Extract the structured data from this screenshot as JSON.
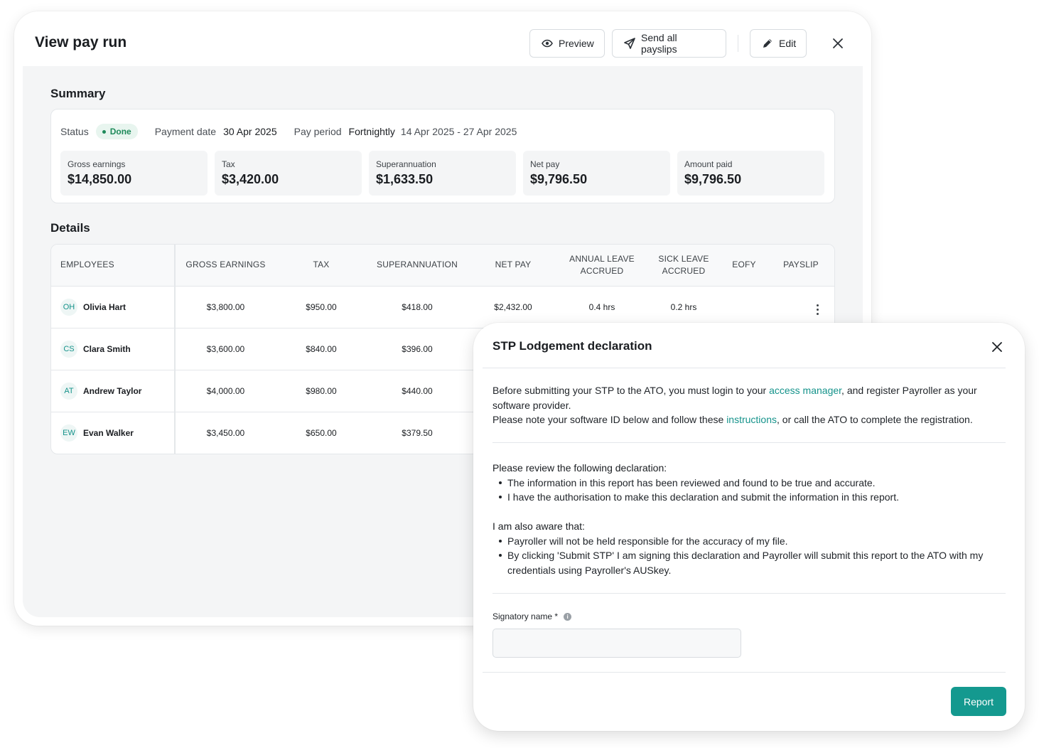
{
  "payrun": {
    "title": "View pay run",
    "toolbar": {
      "preview_label": "Preview",
      "send_label": "Send all payslips",
      "edit_label": "Edit"
    },
    "summary": {
      "title": "Summary",
      "status_label": "Status",
      "status_value": "Done",
      "payment_date_label": "Payment date",
      "payment_date_value": "30 Apr 2025",
      "pay_period_label": "Pay period",
      "pay_period_frequency": "Fortnightly",
      "pay_period_range": "14 Apr 2025 - 27 Apr 2025",
      "stats": [
        {
          "label": "Gross earnings",
          "value": "$14,850.00"
        },
        {
          "label": "Tax",
          "value": "$3,420.00"
        },
        {
          "label": "Superannuation",
          "value": "$1,633.50"
        },
        {
          "label": "Net pay",
          "value": "$9,796.50"
        },
        {
          "label": "Amount paid",
          "value": "$9,796.50"
        }
      ]
    },
    "details": {
      "title": "Details",
      "columns": [
        "EMPLOYEES",
        "GROSS EARNINGS",
        "TAX",
        "SUPERANNUATION",
        "NET PAY",
        "ANNUAL LEAVE ACCRUED",
        "SICK LEAVE ACCRUED",
        "EOFY",
        "PAYSLIP"
      ],
      "rows": [
        {
          "initials": "OH",
          "name": "Olivia Hart",
          "gross": "$3,800.00",
          "tax": "$950.00",
          "super": "$418.00",
          "net": "$2,432.00",
          "annual": "0.4 hrs",
          "sick": "0.2 hrs"
        },
        {
          "initials": "CS",
          "name": "Clara Smith",
          "gross": "$3,600.00",
          "tax": "$840.00",
          "super": "$396.00"
        },
        {
          "initials": "AT",
          "name": "Andrew Taylor",
          "gross": "$4,000.00",
          "tax": "$980.00",
          "super": "$440.00"
        },
        {
          "initials": "EW",
          "name": "Evan Walker",
          "gross": "$3,450.00",
          "tax": "$650.00",
          "super": "$379.50"
        }
      ]
    }
  },
  "modal": {
    "title": "STP Lodgement declaration",
    "intro": {
      "p1_before": "Before submitting your STP to the ATO, you must login to your ",
      "p1_link": "access manager",
      "p1_after": ", and register Payroller as your software provider.",
      "p2_before": "Please note your software ID below and follow these ",
      "p2_link": "instructions",
      "p2_after": ", or call the ATO to complete the registration."
    },
    "declaration": {
      "heading": "Please review the following declaration:",
      "items": [
        "The information in this report has been reviewed and found to be true and accurate.",
        "I have the authorisation to make this declaration and submit the information in this report."
      ]
    },
    "aware": {
      "heading": "I am also aware that:",
      "items": [
        "Payroller will not be held responsible for the accuracy of my file.",
        "By clicking 'Submit STP' I am signing this declaration and Payroller will submit this report to the ATO with my credentials using Payroller's AUSkey."
      ]
    },
    "signatory_label": "Signatory name *",
    "signatory_value": "",
    "report_label": "Report"
  },
  "colors": {
    "accent": "#14998f",
    "link": "#15938b",
    "done_badge_bg": "#e8f5ef",
    "done_badge_text": "#1e8a5a"
  },
  "icons": {
    "preview": "eye-icon",
    "send": "send-icon",
    "edit": "pencil-icon",
    "close": "close-icon",
    "row_menu": "more-vertical-icon",
    "info": "info-icon"
  }
}
